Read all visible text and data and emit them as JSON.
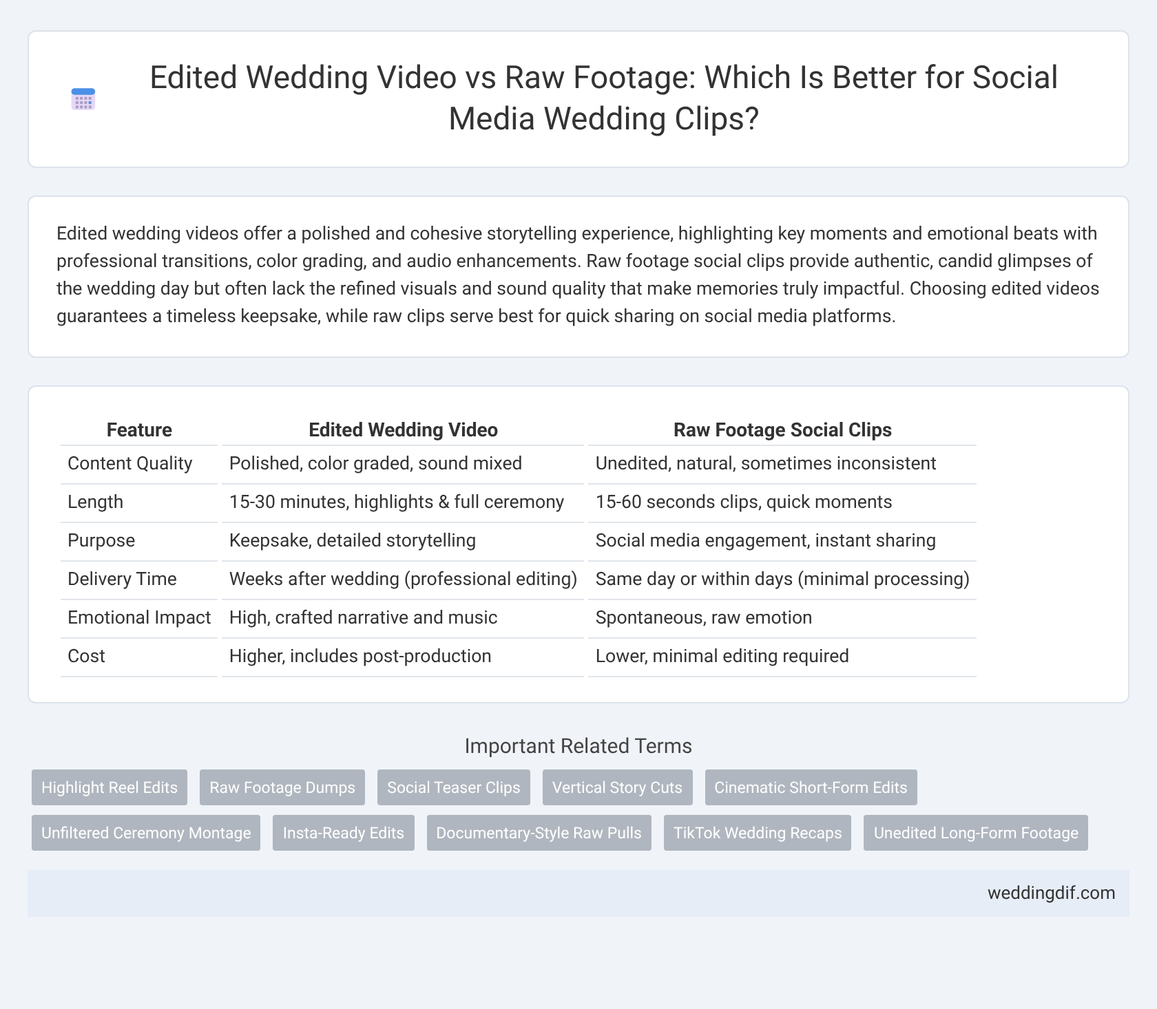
{
  "header": {
    "title": "Edited Wedding Video vs Raw Footage: Which Is Better for Social Media Wedding Clips?"
  },
  "intro": "Edited wedding videos offer a polished and cohesive storytelling experience, highlighting key moments and emotional beats with professional transitions, color grading, and audio enhancements. Raw footage social clips provide authentic, candid glimpses of the wedding day but often lack the refined visuals and sound quality that make memories truly impactful. Choosing edited videos guarantees a timeless keepsake, while raw clips serve best for quick sharing on social media platforms.",
  "table": {
    "columns": [
      "Feature",
      "Edited Wedding Video",
      "Raw Footage Social Clips"
    ],
    "rows": [
      [
        "Content Quality",
        "Polished, color graded, sound mixed",
        "Unedited, natural, sometimes inconsistent"
      ],
      [
        "Length",
        "15-30 minutes, highlights & full ceremony",
        "15-60 seconds clips, quick moments"
      ],
      [
        "Purpose",
        "Keepsake, detailed storytelling",
        "Social media engagement, instant sharing"
      ],
      [
        "Delivery Time",
        "Weeks after wedding (professional editing)",
        "Same day or within days (minimal processing)"
      ],
      [
        "Emotional Impact",
        "High, crafted narrative and music",
        "Spontaneous, raw emotion"
      ],
      [
        "Cost",
        "Higher, includes post-production",
        "Lower, minimal editing required"
      ]
    ]
  },
  "related": {
    "heading": "Important Related Terms",
    "tags": [
      "Highlight Reel Edits",
      "Raw Footage Dumps",
      "Social Teaser Clips",
      "Vertical Story Cuts",
      "Cinematic Short-Form Edits",
      "Unfiltered Ceremony Montage",
      "Insta-Ready Edits",
      "Documentary-Style Raw Pulls",
      "TikTok Wedding Recaps",
      "Unedited Long-Form Footage"
    ]
  },
  "footer": {
    "site": "weddingdif.com"
  }
}
